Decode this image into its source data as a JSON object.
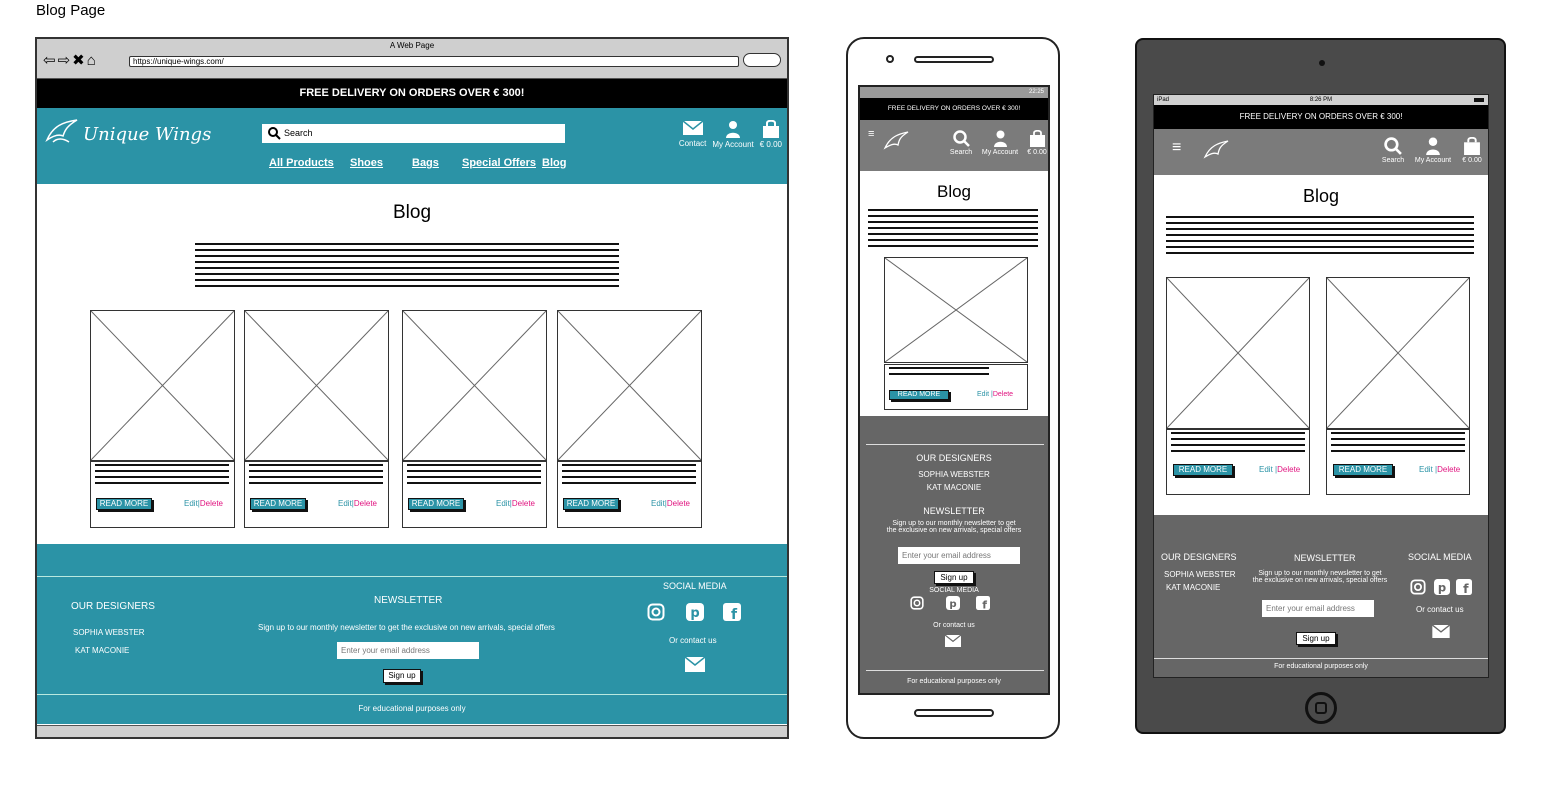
{
  "page": {
    "title": "Blog Page"
  },
  "browser": {
    "window_title": "A Web Page",
    "url": "https://unique-wings.com/"
  },
  "promo": "FREE DELIVERY ON ORDERS OVER € 300!",
  "header": {
    "logo_text": "Unique Wings",
    "search_placeholder": "Search",
    "nav": [
      "All Products",
      "Shoes",
      "Bags",
      "Special Offers",
      "Blog"
    ],
    "tools": {
      "contact": "Contact",
      "account": "My Account",
      "bag": "€ 0.00",
      "search": "Search"
    }
  },
  "main": {
    "title": "Blog",
    "cards": [
      {
        "read_more": "READ MORE",
        "edit": "Edit",
        "sep": "|",
        "delete": "Delete"
      },
      {
        "read_more": "READ MORE",
        "edit": "Edit",
        "sep": "|",
        "delete": "Delete"
      },
      {
        "read_more": "READ MORE",
        "edit": "Edit",
        "sep": "|",
        "delete": "Delete"
      },
      {
        "read_more": "READ MORE",
        "edit": "Edit",
        "sep": "|",
        "delete": "Delete"
      }
    ]
  },
  "footer": {
    "designers_title": "OUR DESIGNERS",
    "designers": [
      "SOPHIA WEBSTER",
      "KAT MACONIE"
    ],
    "newsletter_title": "NEWSLETTER",
    "newsletter_text": "Sign up to our monthly newsletter to get the exclusive on new arrivals, special offers",
    "newsletter_text_a": "Sign up to our monthly newsletter to get",
    "newsletter_text_b": "the exclusive on new arrivals, special offers",
    "email_placeholder": "Enter your email address",
    "signup": "Sign up",
    "social_title": "SOCIAL MEDIA",
    "contact_us": "Or contact us",
    "edu": "For educational purposes only"
  },
  "devices": {
    "phone_time": "22:25",
    "tablet_label": "iPad",
    "tablet_time": "8:26 PM"
  }
}
